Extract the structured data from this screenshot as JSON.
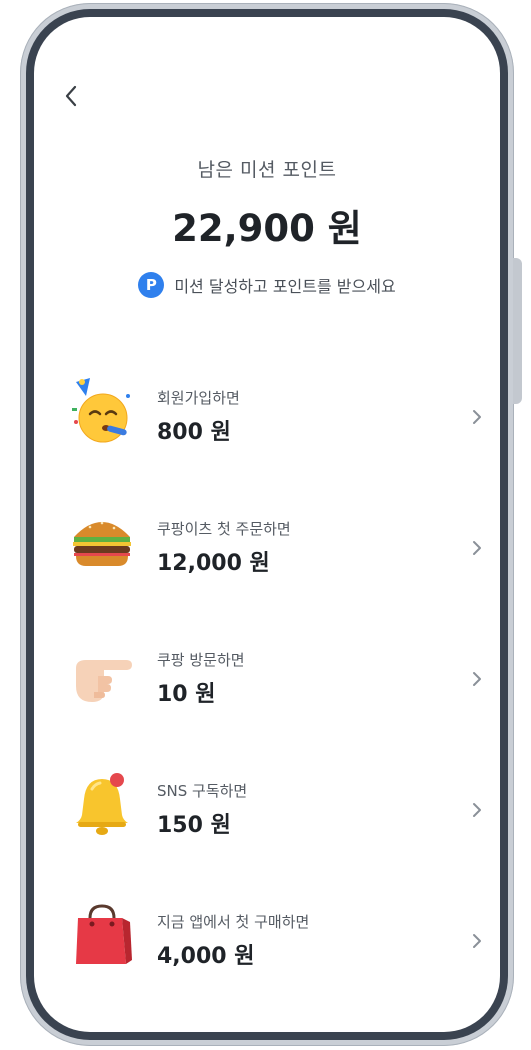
{
  "header": {
    "subtitle": "남은 미션 포인트",
    "points": "22,900 원",
    "hint_badge": "P",
    "hint_text": "미션 달성하고 포인트를 받으세요"
  },
  "missions": [
    {
      "label": "회원가입하면",
      "reward": "800 원",
      "icon": "party-face-icon"
    },
    {
      "label": "쿠팡이츠 첫 주문하면",
      "reward": "12,000 원",
      "icon": "hamburger-icon"
    },
    {
      "label": "쿠팡 방문하면",
      "reward": "10 원",
      "icon": "pointing-hand-icon"
    },
    {
      "label": "SNS 구독하면",
      "reward": "150 원",
      "icon": "bell-icon"
    },
    {
      "label": "지금 앱에서 첫 구매하면",
      "reward": "4,000 원",
      "icon": "shopping-bag-icon"
    }
  ],
  "colors": {
    "accent": "#2f80ed",
    "text_primary": "#1f2328",
    "text_secondary": "#555b63",
    "frame": "#3a4350"
  }
}
